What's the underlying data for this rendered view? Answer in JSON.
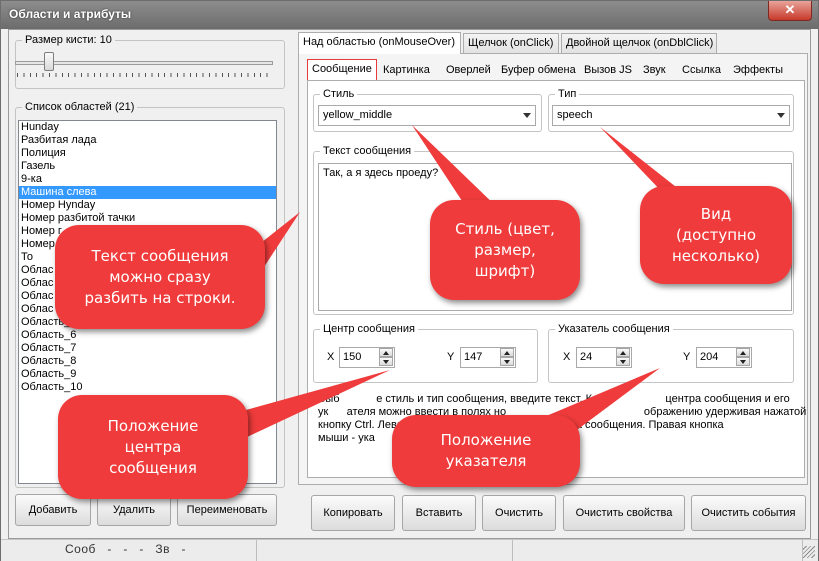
{
  "window": {
    "title": "Области и атрибуты",
    "close_glyph": "✕"
  },
  "brush": {
    "label": "Размер кисти: ",
    "value": "10"
  },
  "areas": {
    "label": "Список областей ",
    "count": "(21)",
    "items": [
      "Hunday",
      "Разбитая лада",
      "Полиция",
      "Газель",
      "9-ка",
      "Машина слева",
      "Номер Hynday",
      "Номер разбитой тачки",
      "Номер г",
      "Номер",
      "То",
      "Облас",
      "Облас",
      "Облас",
      "Облас",
      "Область_5",
      "Область_6",
      "Область_7",
      "Область_8",
      "Область_9",
      "Область_10"
    ],
    "selected_index": 5
  },
  "left_buttons": {
    "add": "Добавить",
    "delete": "Удалить",
    "rename": "Переименовать"
  },
  "outer_tabs": [
    "Над областью (onMouseOver)",
    "Щелчок (onClick)",
    "Двойной щелчок (onDblClick)"
  ],
  "inner_tabs": [
    "Сообщение",
    "Картинка",
    "Оверлей",
    "Буфер обмена",
    "Вызов JS",
    "Звук",
    "Ссылка",
    "Эффекты"
  ],
  "style": {
    "label": "Стиль",
    "value": "yellow_middle"
  },
  "type": {
    "label": "Тип",
    "value": "speech"
  },
  "message": {
    "label": "Текст сообщения",
    "value": "Так, а я здесь проеду?"
  },
  "center": {
    "label": "Центр сообщения",
    "x_label": "X",
    "x": "150",
    "y_label": "Y",
    "y": "147"
  },
  "pointer": {
    "label": "Указатель сообщения",
    "x_label": "X",
    "x": "24",
    "y_label": "Y",
    "y": "204"
  },
  "hint_lines": [
    "Выб            е стиль и тип сообщения, введите текст. Коор                  центра сообщения и его",
    "ук      ателя можно ввести в полях но                   ышкой               ображению удерживая нажатой",
    "кнопку Ctrl. Левая                                             центра сообщения. Правая кнопка",
    "мыши - ука"
  ],
  "bottom_buttons": {
    "copy": "Копировать",
    "paste": "Вставить",
    "clear": "Очистить",
    "clear_props": "Очистить свойства",
    "clear_events": "Очистить события"
  },
  "status": {
    "text": "Сооб   -   -   -   Зв   -"
  },
  "callouts": {
    "text": [
      "Текст сообщения",
      "можно сразу",
      "разбить на строки."
    ],
    "style": [
      "Стиль (цвет,",
      "размер,",
      "шрифт)"
    ],
    "type": [
      "Вид",
      "(доступно",
      "несколько)"
    ],
    "center": [
      "Положение",
      "центра",
      "сообщения"
    ],
    "pointer": [
      "Положение",
      "указателя"
    ]
  },
  "colors": {
    "callout": "#ef3b3b",
    "selection": "#3399ff",
    "active_tab_border": "#e83b3b"
  }
}
